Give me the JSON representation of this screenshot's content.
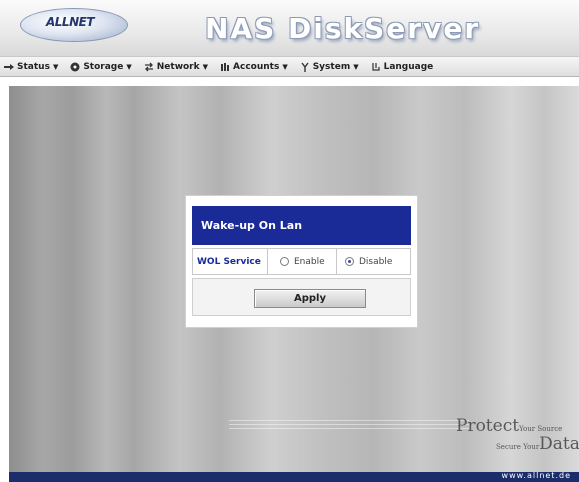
{
  "header": {
    "logo_text": "ALLNET",
    "title": "NAS DiskServer"
  },
  "menu": {
    "items": [
      {
        "label": "Status",
        "icon": "arrow-icon",
        "caret": "▼"
      },
      {
        "label": "Storage",
        "icon": "disk-icon",
        "caret": "▼"
      },
      {
        "label": "Network",
        "icon": "network-icon",
        "caret": "▼"
      },
      {
        "label": "Accounts",
        "icon": "users-icon",
        "caret": "▼"
      },
      {
        "label": "System",
        "icon": "tool-icon",
        "caret": "▼"
      },
      {
        "label": "Language",
        "icon": "language-icon"
      }
    ]
  },
  "dialog": {
    "title": "Wake-up On Lan",
    "field_label": "WOL Service",
    "options": [
      {
        "label": "Enable",
        "checked": false
      },
      {
        "label": "Disable",
        "checked": true
      }
    ],
    "apply_label": "Apply"
  },
  "footer": {
    "slogan_protect": "Protect",
    "slogan_your_source": "Your Source",
    "slogan_secure_your": "Secure Your",
    "slogan_data": "Data",
    "url": "www.allnet.de"
  },
  "colors": {
    "accent": "#1a2a97",
    "bottom_bar": "#1c2d6b"
  }
}
